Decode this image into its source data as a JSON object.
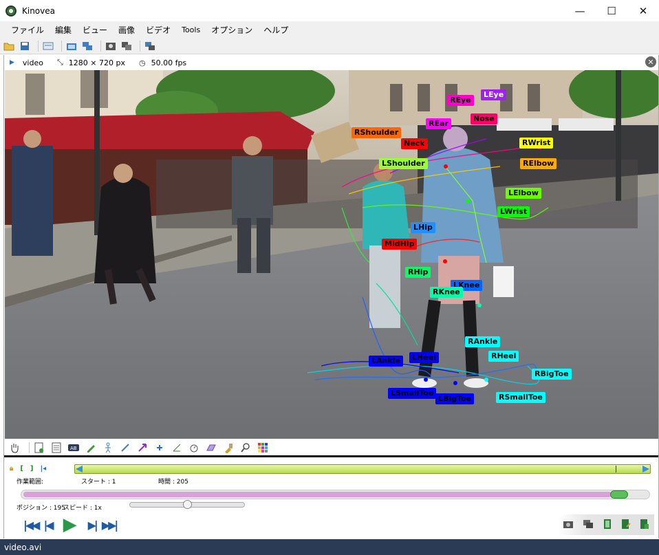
{
  "window": {
    "title": "Kinovea",
    "minimize": "—",
    "maximize": "☐",
    "close": "✕"
  },
  "menu": [
    "ファイル",
    "編集",
    "ビュー",
    "画像",
    "ビデオ",
    "Tools",
    "オプション",
    "ヘルプ"
  ],
  "info": {
    "name": "video",
    "resolution": "1280 × 720 px",
    "fps": "50.00 fps"
  },
  "keypoints": [
    {
      "label": "LEye",
      "bg": "#a020f0",
      "fg": "#ffffff"
    },
    {
      "label": "REye",
      "bg": "#ff00cc",
      "fg": "#000000"
    },
    {
      "label": "Nose",
      "bg": "#ff0066",
      "fg": "#000000"
    },
    {
      "label": "REar",
      "bg": "#ff00ff",
      "fg": "#000000"
    },
    {
      "label": "RShoulder",
      "bg": "#ff6600",
      "fg": "#000000"
    },
    {
      "label": "Neck",
      "bg": "#ff0000",
      "fg": "#000000"
    },
    {
      "label": "RWrist",
      "bg": "#ffff00",
      "fg": "#000000"
    },
    {
      "label": "LShoulder",
      "bg": "#99ff33",
      "fg": "#000000"
    },
    {
      "label": "RElbow",
      "bg": "#ffaa00",
      "fg": "#000000"
    },
    {
      "label": "LElbow",
      "bg": "#66ff00",
      "fg": "#000000"
    },
    {
      "label": "LWrist",
      "bg": "#00ff00",
      "fg": "#000000"
    },
    {
      "label": "LHip",
      "bg": "#1e90ff",
      "fg": "#000000"
    },
    {
      "label": "MidHip",
      "bg": "#ff0000",
      "fg": "#000000"
    },
    {
      "label": "RHip",
      "bg": "#00ff66",
      "fg": "#000000"
    },
    {
      "label": "LKnee",
      "bg": "#0066ff",
      "fg": "#000000"
    },
    {
      "label": "RKnee",
      "bg": "#00ffaa",
      "fg": "#000000"
    },
    {
      "label": "RAnkle",
      "bg": "#00ffff",
      "fg": "#000000"
    },
    {
      "label": "RHeel",
      "bg": "#00ffff",
      "fg": "#000000"
    },
    {
      "label": "LAnkle",
      "bg": "#0000ff",
      "fg": "#000000"
    },
    {
      "label": "LHeel",
      "bg": "#0000ff",
      "fg": "#000000"
    },
    {
      "label": "RBigToe",
      "bg": "#00ffff",
      "fg": "#000000"
    },
    {
      "label": "LSmallToe",
      "bg": "#0000ff",
      "fg": "#000000"
    },
    {
      "label": "LBigToe",
      "bg": "#0000ff",
      "fg": "#000000"
    },
    {
      "label": "RSmallToe",
      "bg": "#00ffff",
      "fg": "#000000"
    }
  ],
  "timeline": {
    "work_range_label": "作業範囲:",
    "start_label": "スタート : 1",
    "duration_label": "時間 : 205",
    "position_label": "ポジション : 195",
    "speed_label": "スピード : 1x",
    "position_fraction": 0.95,
    "speed_fraction": 0.5
  },
  "status": {
    "filename": "video.avi"
  }
}
